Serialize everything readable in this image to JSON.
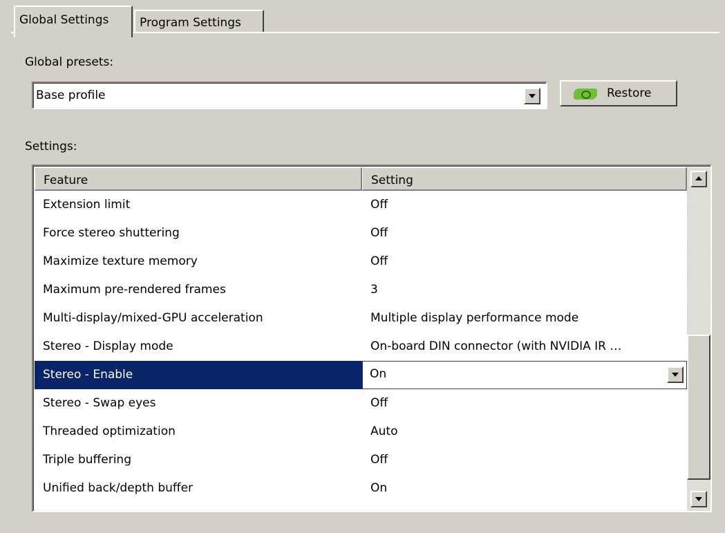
{
  "tabs": [
    {
      "label": "Global Settings",
      "active": true
    },
    {
      "label": "Program Settings",
      "active": false
    }
  ],
  "presets": {
    "label": "Global presets:",
    "value": "Base profile",
    "restore_label": "Restore"
  },
  "settings": {
    "label": "Settings:",
    "columns": [
      "Feature",
      "Setting"
    ],
    "rows": [
      {
        "feature": "Extension limit",
        "setting": "Off"
      },
      {
        "feature": "Force stereo shuttering",
        "setting": "Off"
      },
      {
        "feature": "Maximize texture memory",
        "setting": "Off"
      },
      {
        "feature": "Maximum pre-rendered frames",
        "setting": "3"
      },
      {
        "feature": "Multi-display/mixed-GPU acceleration",
        "setting": "Multiple display performance mode"
      },
      {
        "feature": "Stereo - Display mode",
        "setting": "On-board DIN connector (with NVIDIA IR …"
      },
      {
        "feature": "Stereo - Enable",
        "setting": "On"
      },
      {
        "feature": "Stereo - Swap eyes",
        "setting": "Off"
      },
      {
        "feature": "Threaded optimization",
        "setting": "Auto"
      },
      {
        "feature": "Triple buffering",
        "setting": "Off"
      },
      {
        "feature": "Unified back/depth buffer",
        "setting": "On"
      }
    ]
  },
  "icons": {
    "restore": "nvidia-eye-icon",
    "dropdown": "chevron-down-icon",
    "scroll_up": "scroll-up-arrow-icon",
    "scroll_down": "scroll-down-arrow-icon"
  },
  "colors": {
    "selection": "#0a246a",
    "window": "#d4d0c8"
  }
}
